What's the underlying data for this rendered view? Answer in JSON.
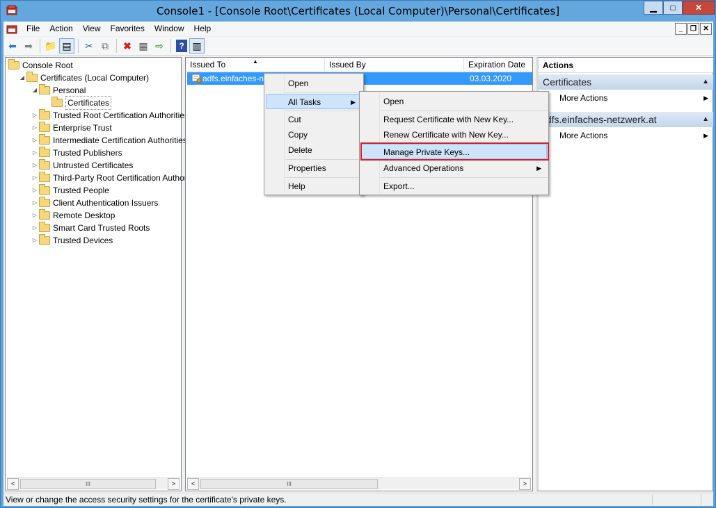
{
  "window": {
    "title": "Console1 - [Console Root\\Certificates (Local Computer)\\Personal\\Certificates]",
    "minimize": "▁",
    "maximize": "□",
    "close": "✕"
  },
  "menubar": {
    "items": [
      "File",
      "Action",
      "View",
      "Favorites",
      "Window",
      "Help"
    ]
  },
  "toolbar": {
    "icons": [
      "back-arrow-icon",
      "forward-arrow-icon",
      "up-folder-icon",
      "show-tree-icon",
      "cut-icon",
      "copy-icon",
      "delete-icon",
      "properties-icon",
      "export-icon",
      "help-icon",
      "show-action-pane-icon"
    ]
  },
  "tree": {
    "items": [
      {
        "label": "Console Root",
        "indent": 0,
        "arrow": ""
      },
      {
        "label": "Certificates (Local Computer)",
        "indent": 1,
        "arrow": "◢"
      },
      {
        "label": "Personal",
        "indent": 2,
        "arrow": "◢"
      },
      {
        "label": "Certificates",
        "indent": 3,
        "arrow": ""
      },
      {
        "label": "Trusted Root Certification Authorities",
        "indent": 2,
        "arrow": "▷"
      },
      {
        "label": "Enterprise Trust",
        "indent": 2,
        "arrow": "▷"
      },
      {
        "label": "Intermediate Certification Authorities",
        "indent": 2,
        "arrow": "▷"
      },
      {
        "label": "Trusted Publishers",
        "indent": 2,
        "arrow": "▷"
      },
      {
        "label": "Untrusted Certificates",
        "indent": 2,
        "arrow": "▷"
      },
      {
        "label": "Third-Party Root Certification Authorities",
        "indent": 2,
        "arrow": "▷"
      },
      {
        "label": "Trusted People",
        "indent": 2,
        "arrow": "▷"
      },
      {
        "label": "Client Authentication Issuers",
        "indent": 2,
        "arrow": "▷"
      },
      {
        "label": "Remote Desktop",
        "indent": 2,
        "arrow": "▷"
      },
      {
        "label": "Smart Card Trusted Roots",
        "indent": 2,
        "arrow": "▷"
      },
      {
        "label": "Trusted Devices",
        "indent": 2,
        "arrow": "▷"
      }
    ]
  },
  "list": {
    "columns": [
      "Issued To",
      "Issued By",
      "Expiration Date"
    ],
    "rows": [
      {
        "issued_to": "adfs.einfaches-ne",
        "issued_by": "",
        "expiration": "03.03.2020"
      }
    ]
  },
  "actions": {
    "header": "Actions",
    "sections": [
      {
        "title": "Certificates",
        "item": "More Actions"
      },
      {
        "title": "adfs.einfaches-netzwerk.at",
        "item": "More Actions"
      }
    ]
  },
  "context_menu": {
    "items": [
      "Open",
      "All Tasks",
      "Cut",
      "Copy",
      "Delete",
      "Properties",
      "Help"
    ]
  },
  "submenu": {
    "items": [
      "Open",
      "Request Certificate with New Key...",
      "Renew Certificate with New Key...",
      "Manage Private Keys...",
      "Advanced Operations",
      "Export..."
    ]
  },
  "status": {
    "text": "View or change the access security settings for the certificate's private keys."
  },
  "scroll": {
    "thumb_glyph": "III",
    "left_arrow": "<",
    "right_arrow": ">"
  },
  "colors": {
    "selection": "#3399ff",
    "highlight_box": "#d6202e",
    "title_bar": "#63a7de"
  }
}
